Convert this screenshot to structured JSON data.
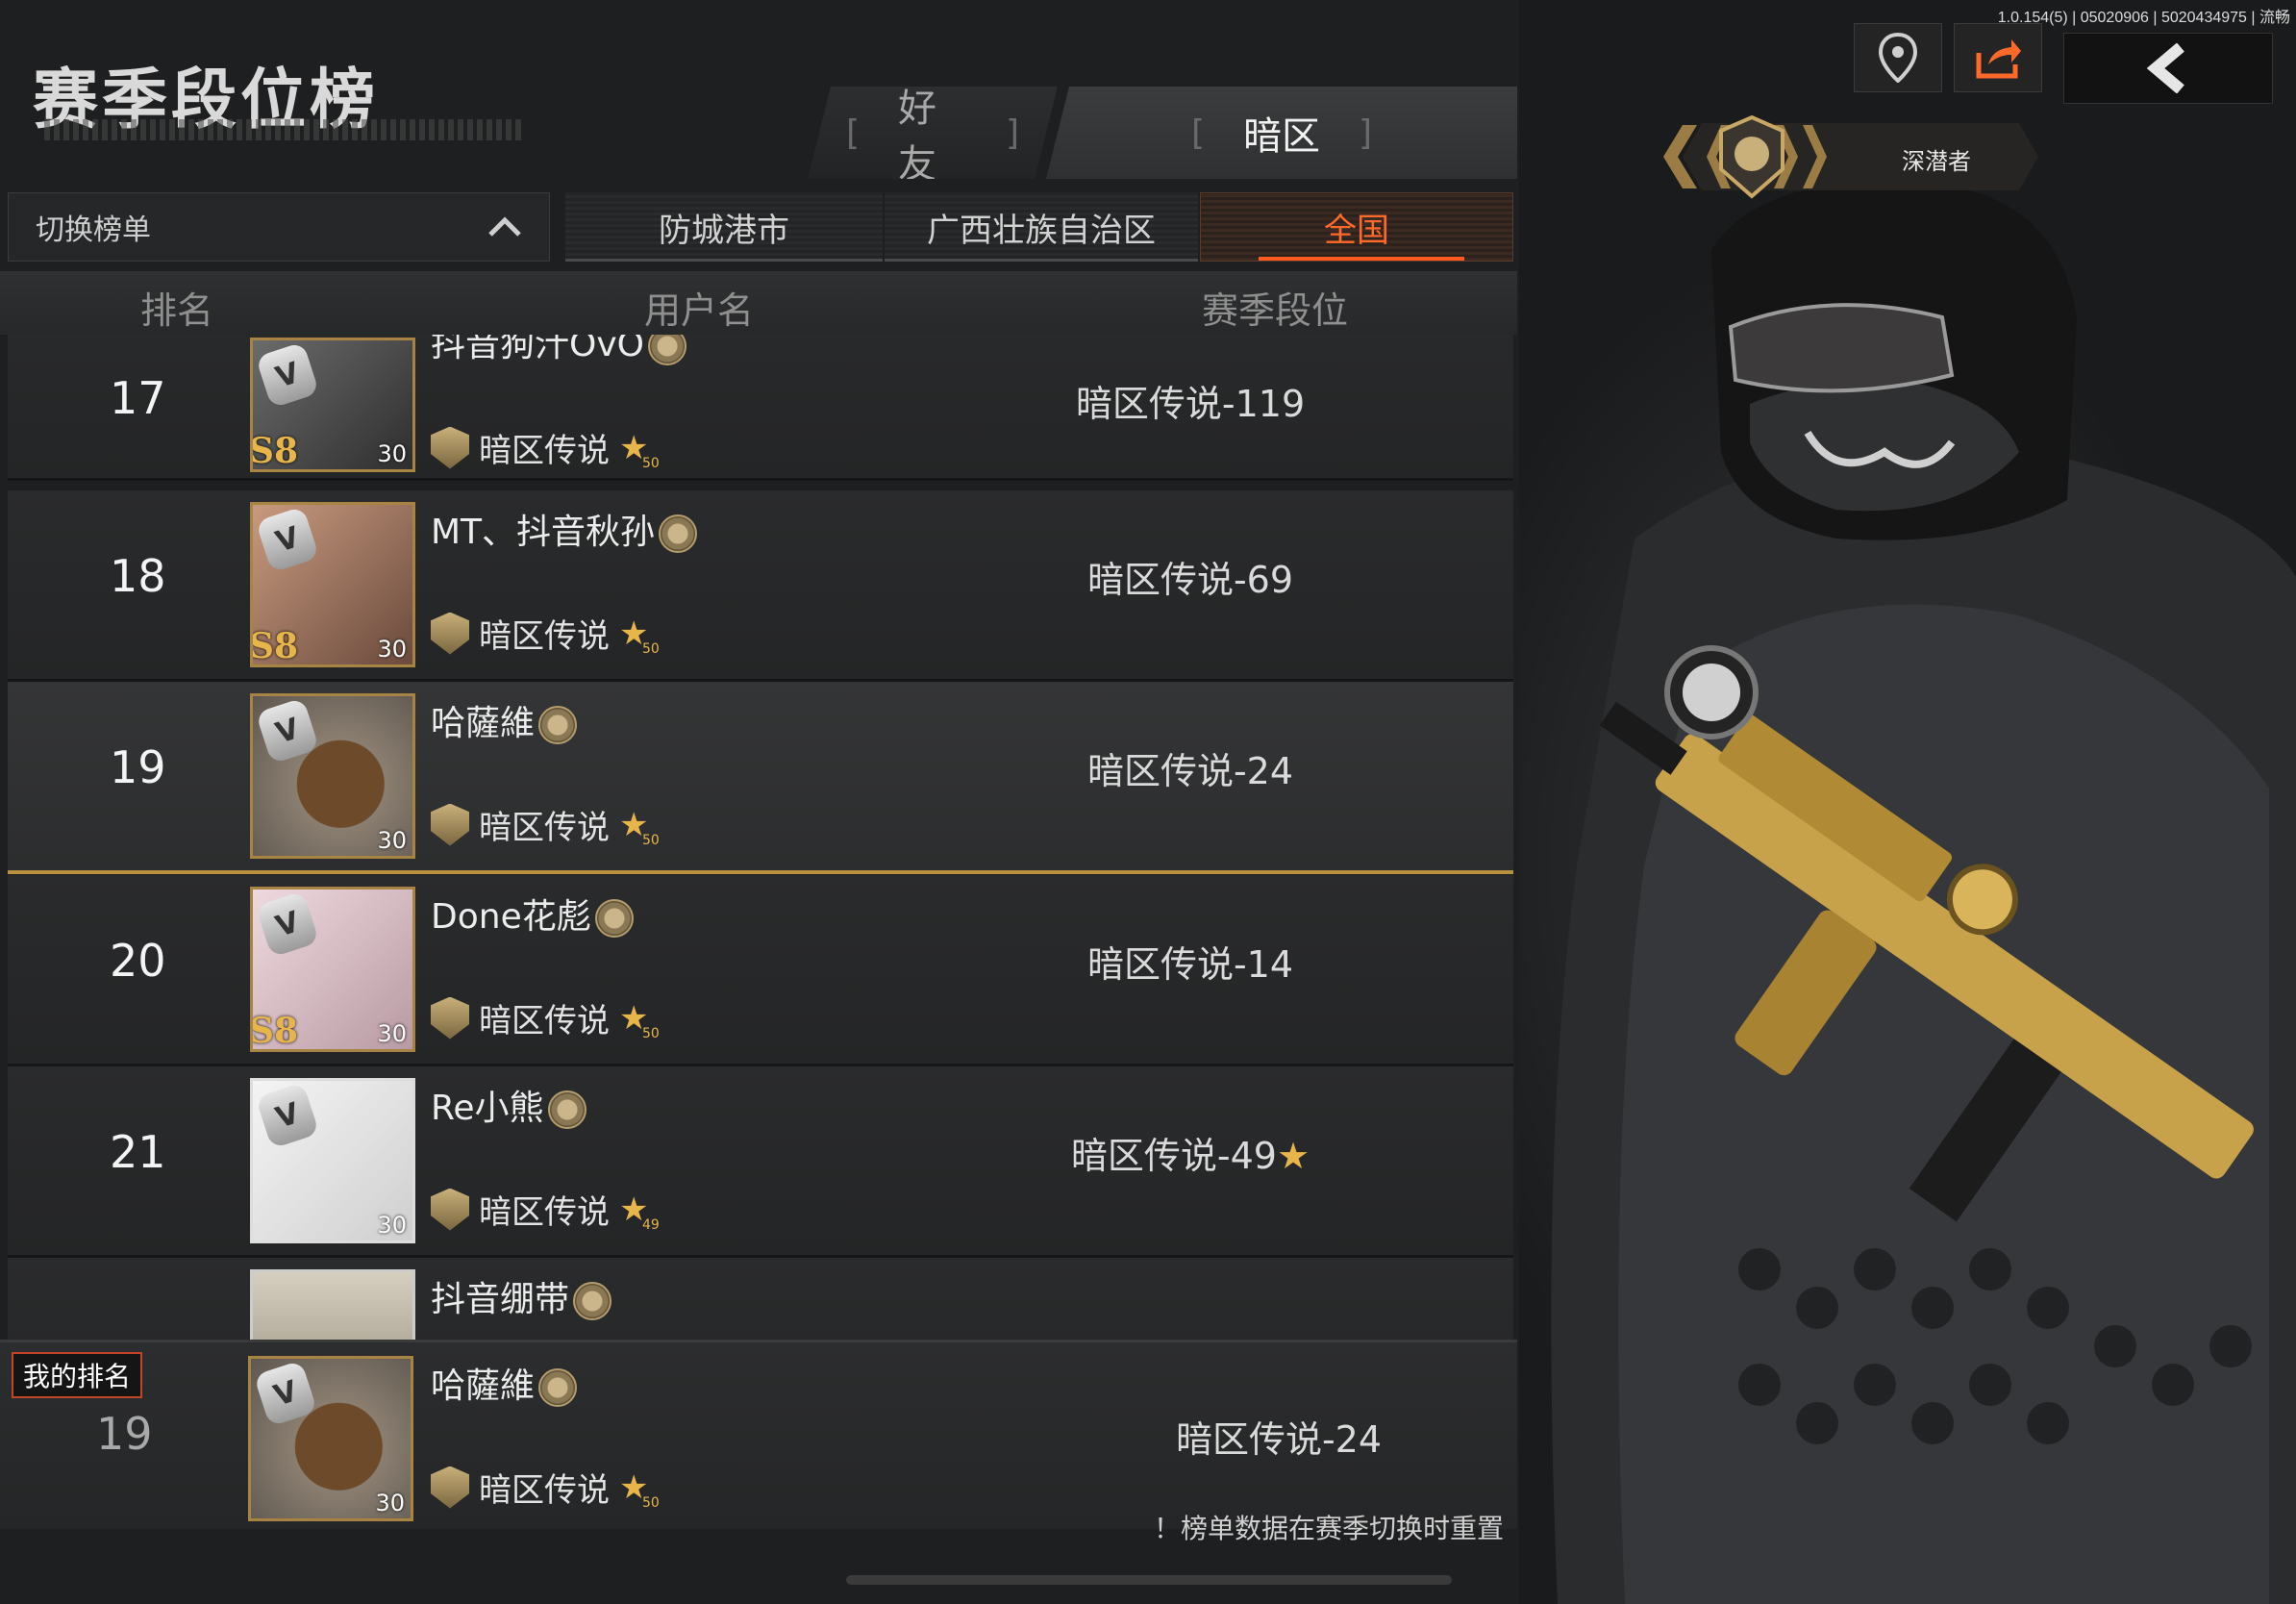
{
  "version": "1.0.154(5) | 05020906 | 5020434975 | 流畅",
  "page_title": "赛季段位榜",
  "main_tabs": [
    {
      "label": "好友",
      "active": false
    },
    {
      "label": "暗区",
      "active": true
    }
  ],
  "switch_board": {
    "label": "切换榜单",
    "icon": "chevron-up-icon"
  },
  "region_tabs": [
    {
      "label": "防城港市",
      "active": false
    },
    {
      "label": "广西壮族自治区",
      "active": false
    },
    {
      "label": "全国",
      "active": true
    }
  ],
  "headers": {
    "rank": "排名",
    "username": "用户名",
    "season_rank": "赛季段位"
  },
  "rows": [
    {
      "rank": "17",
      "name": "抖音狗汁OvO",
      "tier": "暗区传说",
      "star_count": "50",
      "season_rank": "暗区传说-119",
      "season": "S8",
      "level": "30"
    },
    {
      "rank": "18",
      "name": "MT、抖音秋孙",
      "tier": "暗区传说",
      "star_count": "50",
      "season_rank": "暗区传说-69",
      "season": "S8",
      "level": "30"
    },
    {
      "rank": "19",
      "name": "哈薩維",
      "tier": "暗区传说",
      "star_count": "50",
      "season_rank": "暗区传说-24",
      "season": "",
      "level": "30"
    },
    {
      "rank": "20",
      "name": "Done花彪",
      "tier": "暗区传说",
      "star_count": "50",
      "season_rank": "暗区传说-14",
      "season": "S8",
      "level": "30"
    },
    {
      "rank": "21",
      "name": "Re小熊",
      "tier": "暗区传说",
      "star_count": "49",
      "season_rank": "暗区传说-49",
      "season": "",
      "level": "30"
    },
    {
      "rank": "",
      "name": "抖音绷带",
      "tier": "",
      "star_count": "",
      "season_rank": "",
      "season": "",
      "level": ""
    }
  ],
  "self": {
    "label": "我的排名",
    "rank": "19",
    "name": "哈薩維",
    "tier": "暗区传说",
    "star_count": "50",
    "season_rank": "暗区传说-24",
    "level": "30"
  },
  "footer_note": "！榜单数据在赛季切换时重置",
  "player_title": "深潜者",
  "colors": {
    "accent": "#ff5a1f",
    "gold": "#e8b54a",
    "self_highlight": "#b8923f"
  }
}
